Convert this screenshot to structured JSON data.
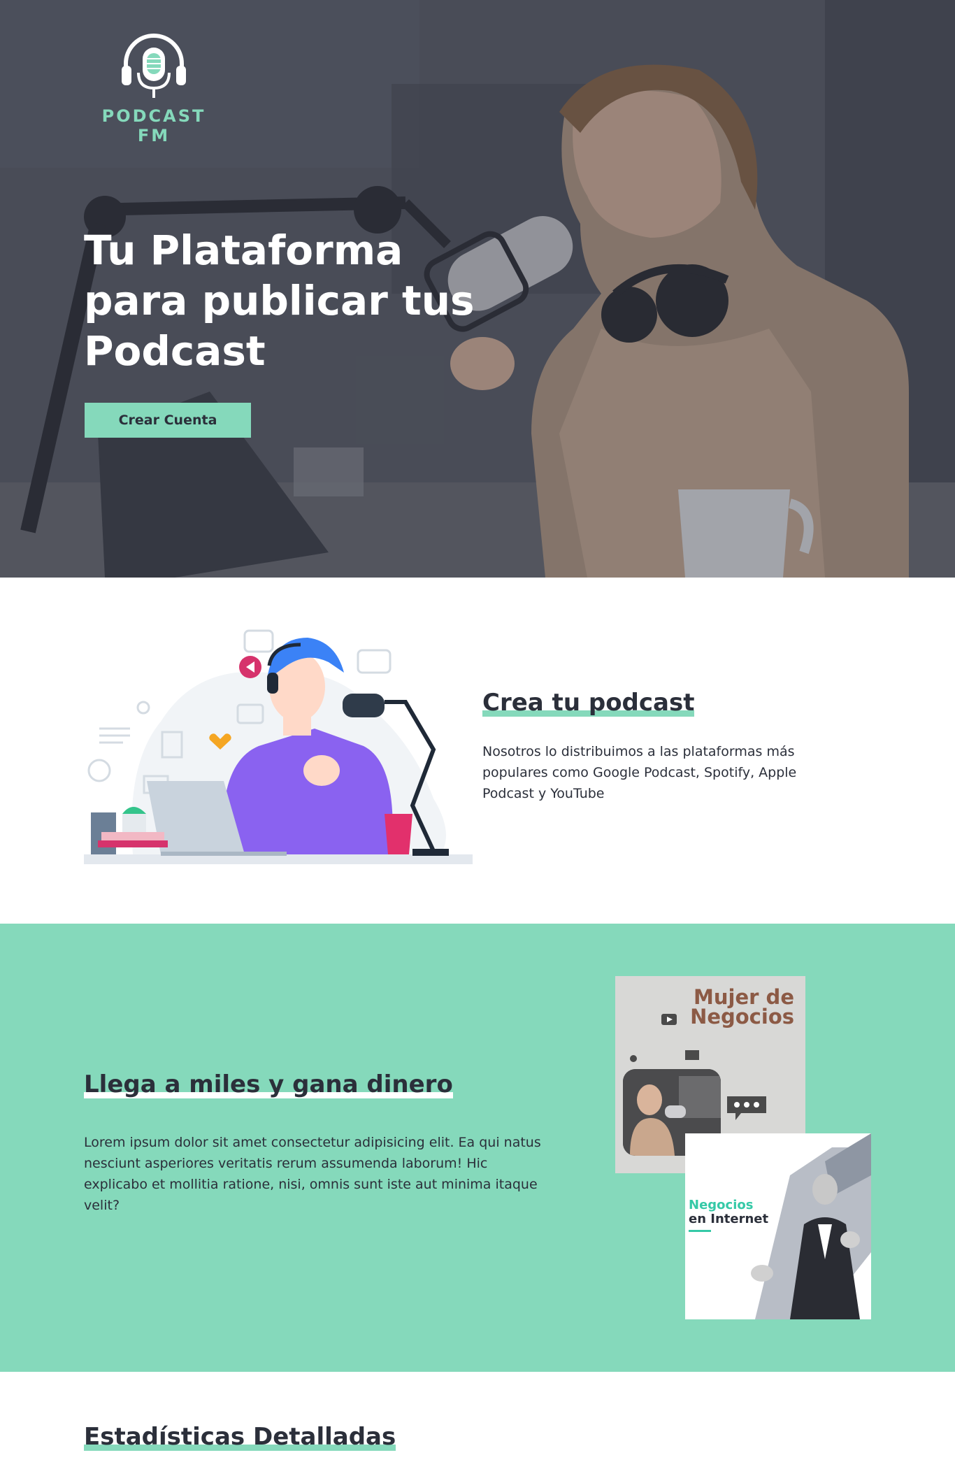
{
  "brand": {
    "name": "PODCAST FM",
    "accent": "#85d9bb",
    "dark": "#2b2f3a"
  },
  "hero": {
    "title": "Tu Plataforma para publicar tus Podcast",
    "cta_label": "Crear Cuenta"
  },
  "create": {
    "title": "Crea tu podcast",
    "text": "Nosotros lo distribuimos a las plataformas más populares como Google Podcast, Spotify, Apple Podcast y YouTube"
  },
  "reach": {
    "title": "Llega a miles y gana dinero",
    "text": "Lorem ipsum dolor sit amet consectetur adipisicing elit. Ea qui natus nesciunt asperiores veritatis rerum assumenda laborum! Hic explicabo et mollitia ratione, nisi, omnis sunt iste aut minima itaque velit?",
    "card_a_title": "Mujer de Negocios",
    "card_b_line1": "Negocios",
    "card_b_line2": "en Internet"
  },
  "stats": {
    "title": "Estadísticas Detalladas"
  }
}
